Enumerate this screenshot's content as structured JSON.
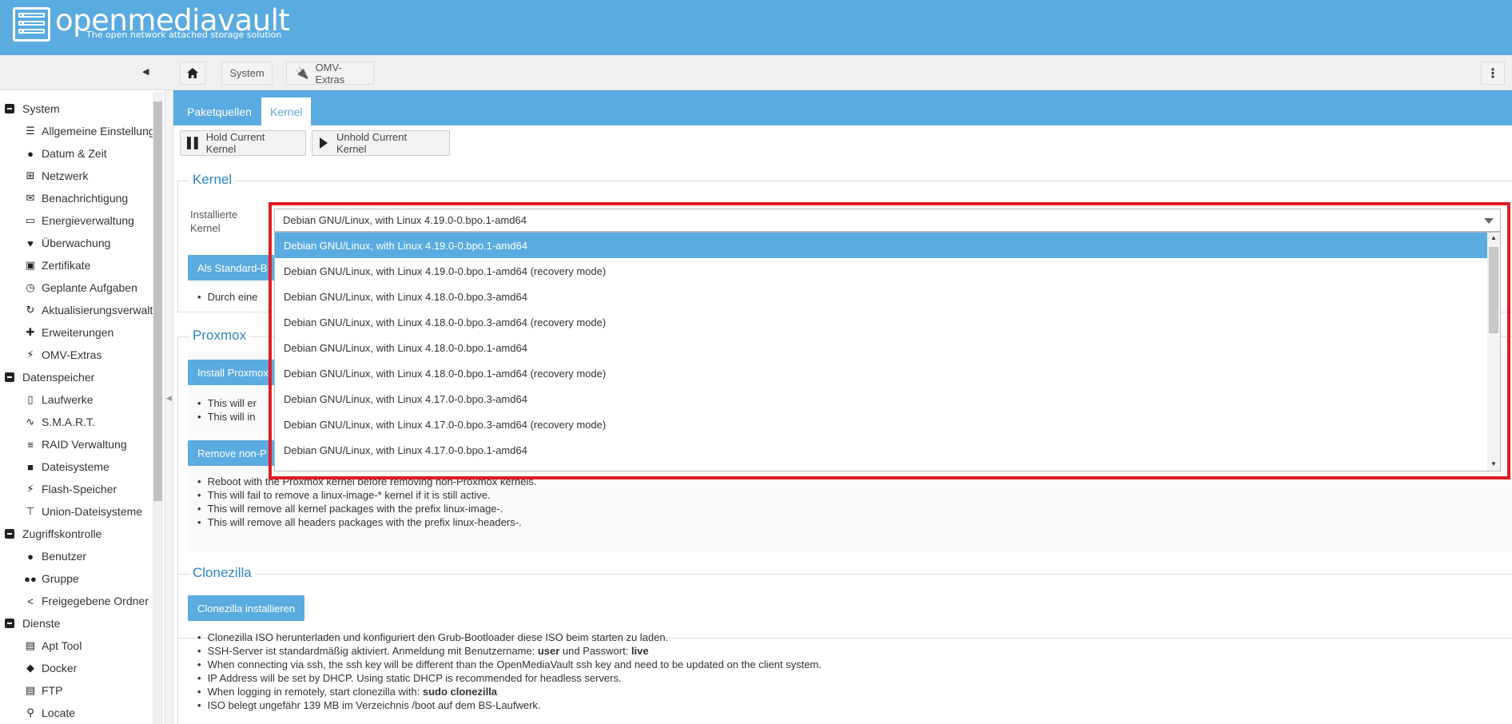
{
  "header": {
    "app_name": "openmediavault",
    "tagline": "The open network attached storage solution"
  },
  "toolbar": {
    "breadcrumbs": [
      "System",
      "OMV-Extras"
    ]
  },
  "sidebar": {
    "groups": [
      {
        "label": "System",
        "items": [
          {
            "label": "Allgemeine Einstellung",
            "icon": "sliders-icon"
          },
          {
            "label": "Datum & Zeit",
            "icon": "clock-icon"
          },
          {
            "label": "Netzwerk",
            "icon": "network-icon"
          },
          {
            "label": "Benachrichtigung",
            "icon": "envelope-icon"
          },
          {
            "label": "Energieverwaltung",
            "icon": "battery-icon"
          },
          {
            "label": "Überwachung",
            "icon": "heartbeat-icon"
          },
          {
            "label": "Zertifikate",
            "icon": "certificate-icon"
          },
          {
            "label": "Geplante Aufgaben",
            "icon": "calendar-clock-icon"
          },
          {
            "label": "Aktualisierungsverwalt",
            "icon": "refresh-icon"
          },
          {
            "label": "Erweiterungen",
            "icon": "puzzle-icon"
          },
          {
            "label": "OMV-Extras",
            "icon": "plug-icon"
          }
        ]
      },
      {
        "label": "Datenspeicher",
        "items": [
          {
            "label": "Laufwerke",
            "icon": "disk-icon"
          },
          {
            "label": "S.M.A.R.T.",
            "icon": "pulse-icon"
          },
          {
            "label": "RAID Verwaltung",
            "icon": "database-icon"
          },
          {
            "label": "Dateisysteme",
            "icon": "folder-icon"
          },
          {
            "label": "Flash-Speicher",
            "icon": "bolt-icon"
          },
          {
            "label": "Union-Dateisysteme",
            "icon": "sitemap-icon"
          }
        ]
      },
      {
        "label": "Zugriffskontrolle",
        "items": [
          {
            "label": "Benutzer",
            "icon": "user-icon"
          },
          {
            "label": "Gruppe",
            "icon": "users-icon"
          },
          {
            "label": "Freigegebene Ordner",
            "icon": "share-icon"
          }
        ]
      },
      {
        "label": "Dienste",
        "items": [
          {
            "label": "Apt Tool",
            "icon": "apt-icon"
          },
          {
            "label": "Docker",
            "icon": "docker-icon"
          },
          {
            "label": "FTP",
            "icon": "server-icon"
          },
          {
            "label": "Locate",
            "icon": "search-icon"
          }
        ]
      }
    ]
  },
  "tabs": [
    "Paketquellen",
    "Kernel"
  ],
  "active_tab": "Kernel",
  "buttons": {
    "hold": "Hold Current Kernel",
    "unhold": "Unhold Current Kernel"
  },
  "kernel": {
    "legend": "Kernel",
    "field_label": "Installierte Kernel",
    "selected_value": "Debian GNU/Linux, with Linux 4.19.0-0.bpo.1-amd64",
    "default_button": "Als Standard-B",
    "note": "Durch eine",
    "options": [
      "Debian GNU/Linux, with Linux 4.19.0-0.bpo.1-amd64",
      "Debian GNU/Linux, with Linux 4.19.0-0.bpo.1-amd64 (recovery mode)",
      "Debian GNU/Linux, with Linux 4.18.0-0.bpo.3-amd64",
      "Debian GNU/Linux, with Linux 4.18.0-0.bpo.3-amd64 (recovery mode)",
      "Debian GNU/Linux, with Linux 4.18.0-0.bpo.1-amd64",
      "Debian GNU/Linux, with Linux 4.18.0-0.bpo.1-amd64 (recovery mode)",
      "Debian GNU/Linux, with Linux 4.17.0-0.bpo.3-amd64",
      "Debian GNU/Linux, with Linux 4.17.0-0.bpo.3-amd64 (recovery mode)",
      "Debian GNU/Linux, with Linux 4.17.0-0.bpo.1-amd64"
    ]
  },
  "proxmox": {
    "legend": "Proxmox",
    "install_button": "Install Proxmox",
    "install_notes": [
      "This will er",
      "This will in"
    ],
    "remove_button": "Remove non-P",
    "remove_notes": [
      "Reboot with the Proxmox kernel before removing non-Proxmox kernels.",
      "This will fail to remove a linux-image-* kernel if it is still active.",
      "This will remove all kernel packages with the prefix linux-image-.",
      "This will remove all headers packages with the prefix linux-headers-."
    ]
  },
  "clonezilla": {
    "legend": "Clonezilla",
    "install_button": "Clonezilla installieren",
    "notes": [
      {
        "pre": "Clonezilla ISO herunterladen und konfiguriert den Grub-Bootloader diese ISO beim starten zu laden.",
        "b1": "",
        "mid": "",
        "b2": ""
      },
      {
        "pre": "SSH-Server ist standardmäßig aktiviert. Anmeldung mit Benutzername: ",
        "b1": "user",
        "mid": " und Passwort: ",
        "b2": "live"
      },
      {
        "pre": "When connecting via ssh, the ssh key will be different than the OpenMediaVault ssh key and need to be updated on the client system.",
        "b1": "",
        "mid": "",
        "b2": ""
      },
      {
        "pre": "IP Address will be set by DHCP. Using static DHCP is recommended for headless servers.",
        "b1": "",
        "mid": "",
        "b2": ""
      },
      {
        "pre": "When logging in remotely, start clonezilla with: ",
        "b1": "sudo clonezilla",
        "mid": "",
        "b2": ""
      },
      {
        "pre": "ISO belegt ungefähr 139 MB im Verzeichnis /boot auf dem BS-Laufwerk.",
        "b1": "",
        "mid": "",
        "b2": ""
      }
    ]
  },
  "colors": {
    "accent": "#5aabdf",
    "legend": "#2f86c3",
    "highlight": "#e01b24"
  }
}
